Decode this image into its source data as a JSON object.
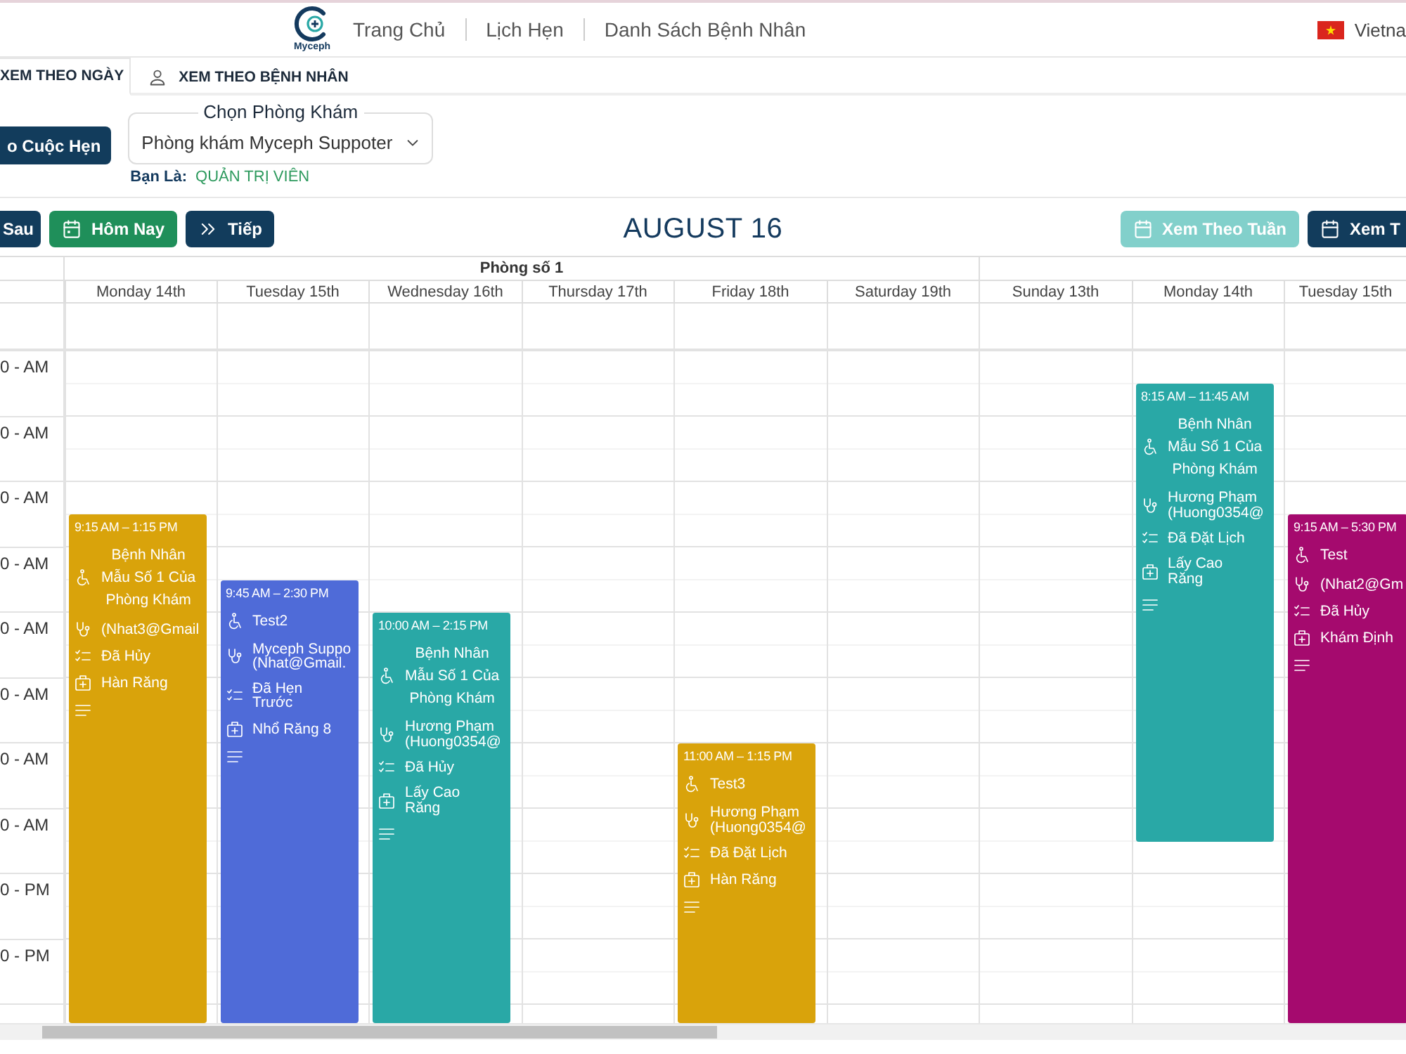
{
  "header": {
    "logo_text": "Myceph",
    "nav": [
      "Trang Chủ",
      "Lịch Hẹn",
      "Danh Sách Bệnh Nhân"
    ],
    "language": "Vietna"
  },
  "tabs": [
    {
      "label": "XEM THEO NGÀY",
      "selected": true
    },
    {
      "label": "XEM THEO BỆNH NHÂN",
      "selected": false
    }
  ],
  "create_button": "o Cuộc Hẹn",
  "clinic_select": {
    "label": "Chọn Phòng Khám",
    "value": "Phòng khám Myceph Suppoter"
  },
  "role": {
    "label": "Bạn Là:",
    "value": "QUẢN TRỊ VIÊN"
  },
  "toolbar": {
    "nav_buttons": [
      {
        "kind": "prev",
        "label": "Sau"
      },
      {
        "kind": "today",
        "label": "Hôm Nay"
      },
      {
        "kind": "next",
        "label": "Tiếp"
      }
    ],
    "title": "AUGUST 16",
    "view_buttons": [
      {
        "label": "Xem Theo Tuần",
        "selected": true
      },
      {
        "label": "Xem T",
        "selected": false
      }
    ]
  },
  "calendar": {
    "room": "Phòng số 1",
    "days": [
      {
        "label": "Monday 14th",
        "events": [
          {
            "time": "9:15 AM – 1:15 PM",
            "patient": "Bệnh Nhân\nMẫu Số 1 Của\nPhòng Khám",
            "doctor": "(Nhat3@Gmail",
            "status": "Đã Hủy",
            "service": "Hàn Răng",
            "color": "#d9a30b"
          }
        ]
      },
      {
        "label": "Tuesday 15th",
        "events": [
          {
            "time": "9:45 AM – 2:30 PM",
            "patient": "Test2",
            "doctor": "Myceph Suppo\n(Nhat@Gmail.",
            "status": "Đã Hẹn\nTrước",
            "service": "Nhổ Răng 8",
            "color": "#4f6bd8"
          }
        ]
      },
      {
        "label": "Wednesday 16th",
        "events": [
          {
            "time": "10:00 AM – 2:15 PM",
            "patient": "Bệnh Nhân\nMẫu Số 1 Của\nPhòng Khám",
            "doctor": "Hương Phạm\n(Huong0354@",
            "status": "Đã Hủy",
            "service": "Lấy Cao\nRăng",
            "color": "#29a8a6"
          }
        ]
      },
      {
        "label": "Thursday 17th"
      },
      {
        "label": "Friday 18th",
        "events": [
          {
            "time": "11:00 AM – 1:15 PM",
            "patient": "Test3",
            "doctor": "Hương Phạm\n(Huong0354@",
            "status": "Đã Đặt Lịch",
            "service": "Hàn Răng",
            "color": "#d9a30b"
          }
        ]
      },
      {
        "label": "Saturday 19th"
      },
      {
        "label": "Sunday 13th"
      },
      {
        "label": "Monday 14th",
        "events": [
          {
            "time": "8:15 AM – 11:45 AM",
            "patient": "Bệnh Nhân\nMẫu Số 1 Của\nPhòng Khám",
            "doctor": "Hương Phạm\n(Huong0354@",
            "status": "Đã Đặt Lịch",
            "service": "Lấy Cao\nRăng",
            "color": "#29a8a6"
          }
        ]
      },
      {
        "label": "Tuesday 15th",
        "events": [
          {
            "time": "9:15 AM – 5:30 PM",
            "patient": "Test",
            "doctor": "(Nhat2@Gm",
            "status": "Đã Hủy",
            "service": "Khám Định",
            "color": "#a50a6e"
          }
        ]
      }
    ],
    "time_labels": [
      "0 - AM",
      "0 - AM",
      "0 - AM",
      "0 - AM",
      "0 - AM",
      "0 - AM",
      "0 - AM",
      "0 - AM",
      "0 - PM",
      "0 - PM"
    ]
  }
}
